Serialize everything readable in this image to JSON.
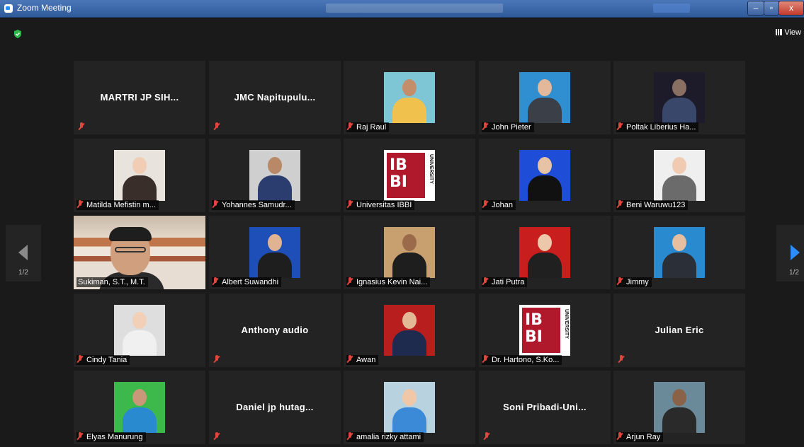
{
  "window": {
    "title": "Zoom Meeting",
    "view_label": "View"
  },
  "pager": {
    "left": "1/2",
    "right": "1/2"
  },
  "participants": [
    {
      "kind": "name",
      "name": "MARTRI JP SIH..."
    },
    {
      "kind": "name",
      "name": "JMC  Napitupulu..."
    },
    {
      "kind": "photo",
      "name": "Raj Raul",
      "bg": "#7ec6d6",
      "skin": "#c58e6b",
      "cloth": "#f0c14d"
    },
    {
      "kind": "photo",
      "name": "John Pieter",
      "bg": "#2f8fd0",
      "skin": "#e4b89a",
      "cloth": "#3a3f48"
    },
    {
      "kind": "photo",
      "name": "Poltak Liberius Ha...",
      "bg": "#1d1a2a",
      "skin": "#8a7062",
      "cloth": "#39476a"
    },
    {
      "kind": "photo",
      "name": "Matilda Mefistin m...",
      "bg": "#e8e3dd",
      "skin": "#f0cdb4",
      "cloth": "#3a2e2a"
    },
    {
      "kind": "photo",
      "name": "Yohannes Samudr...",
      "bg": "#cfcfcf",
      "skin": "#b88867",
      "cloth": "#2b3d6e"
    },
    {
      "kind": "logo",
      "name": "Universitas IBBI",
      "logo_text": "IB\nBI",
      "logo_side": "UNIVERSITY"
    },
    {
      "kind": "photo",
      "name": "Johan",
      "bg": "#1e4ed8",
      "skin": "#e8c2a4",
      "cloth": "#111111"
    },
    {
      "kind": "photo",
      "name": "Beni Waruwu123",
      "bg": "#efefef",
      "skin": "#f0cbb2",
      "cloth": "#6b6b6b"
    },
    {
      "kind": "video",
      "name": "Sukiman, S.T., M.T."
    },
    {
      "kind": "photo",
      "name": "Albert Suwandhi",
      "bg": "#1e4eb8",
      "skin": "#e0b392",
      "cloth": "#1e1e1e"
    },
    {
      "kind": "photo",
      "name": "Ignasius Kevin Nai...",
      "bg": "#c8a070",
      "skin": "#9a6a4a",
      "cloth": "#1e1e1e"
    },
    {
      "kind": "photo",
      "name": "Jati Putra",
      "bg": "#c81e1e",
      "skin": "#ecc7aa",
      "cloth": "#202020"
    },
    {
      "kind": "photo",
      "name": "Jimmy",
      "bg": "#2a8ad0",
      "skin": "#e6bea0",
      "cloth": "#2b2f38"
    },
    {
      "kind": "photo",
      "name": "Cindy Tania",
      "bg": "#dedede",
      "skin": "#f2d0b8",
      "cloth": "#f0f0f0"
    },
    {
      "kind": "name",
      "name": "Anthony audio"
    },
    {
      "kind": "photo",
      "name": "Awan",
      "bg": "#b81e1e",
      "skin": "#e2b896",
      "cloth": "#1f2b4e"
    },
    {
      "kind": "logo",
      "name": "Dr. Hartono, S.Ko...",
      "logo_text": "IB\nBI",
      "logo_side": "UNIVERSITY"
    },
    {
      "kind": "name",
      "name": "Julian Eric"
    },
    {
      "kind": "photo",
      "name": "Elyas Manurung",
      "bg": "#3db84a",
      "skin": "#c89878",
      "cloth": "#2a8ad0"
    },
    {
      "kind": "name",
      "name": "Daniel  jp  hutag..."
    },
    {
      "kind": "photo",
      "name": "amalia rizky attami",
      "bg": "#b8d2e0",
      "skin": "#f0c8a8",
      "cloth": "#3a8ad8"
    },
    {
      "kind": "name",
      "name": "Soni  Pribadi-Uni..."
    },
    {
      "kind": "photo",
      "name": "Arjun Ray",
      "bg": "#6a8a9a",
      "skin": "#8a6248",
      "cloth": "#2a2a2a"
    }
  ]
}
